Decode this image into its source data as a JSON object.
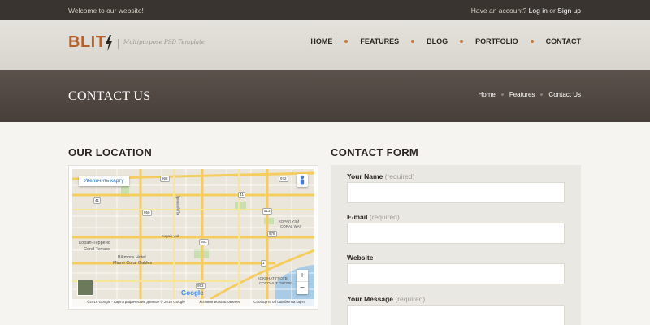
{
  "topbar": {
    "welcome": "Welcome to our website!",
    "account_prompt": "Have an account?",
    "login": "Log in",
    "or": "or",
    "signup": "Sign up"
  },
  "header": {
    "logo": "BLIT",
    "tagline": "Multipurpose PSD Template",
    "nav": [
      "HOME",
      "FEATURES",
      "BLOG",
      "PORTFOLIO",
      "CONTACT"
    ]
  },
  "band": {
    "title": "CONTACT US",
    "breadcrumb": [
      "Home",
      "Features",
      "Contact Us"
    ]
  },
  "location": {
    "heading": "OUR LOCATION",
    "map": {
      "enlarge_button": "Увеличить карту",
      "zoom_in": "+",
      "zoom_out": "−",
      "google": "Google",
      "footer": "©2016 Google - Картографические данные © 2016 Google",
      "terms": "Условия использования",
      "report": "Сообщить об ошибке на карте",
      "places": {
        "coral_terrace_ru": "Корал-Террейс",
        "coral_terrace": "Coral Terrace",
        "biltmore": "Biltmore Hotel",
        "miami_coral_gables": "Miami Coral Gables",
        "coral_way_ru": "КОРАЛ УЭЙ",
        "coral_way": "CORAL WAY",
        "coconut_grove_ru": "КОКОНАТ ГРОУВ",
        "coconut_grove": "COCONUT GROVE",
        "greenway": "Гринвей-Пк",
        "coral_way_road": "Корал-уэй"
      },
      "road_numbers": [
        "968",
        "41",
        "953",
        "959",
        "913",
        "41",
        "972",
        "953",
        "976",
        "1"
      ]
    }
  },
  "contact_form": {
    "heading": "CONTACT FORM",
    "fields": [
      {
        "label": "Your Name",
        "required": "(required)"
      },
      {
        "label": "E-mail",
        "required": "(required)"
      },
      {
        "label": "Website",
        "required": ""
      },
      {
        "label": "Your Message",
        "required": "(required)"
      }
    ]
  },
  "colors": {
    "accent": "#b5612c",
    "topbar": "#3a3430",
    "band": "#514842",
    "background": "#f5f4f0"
  }
}
